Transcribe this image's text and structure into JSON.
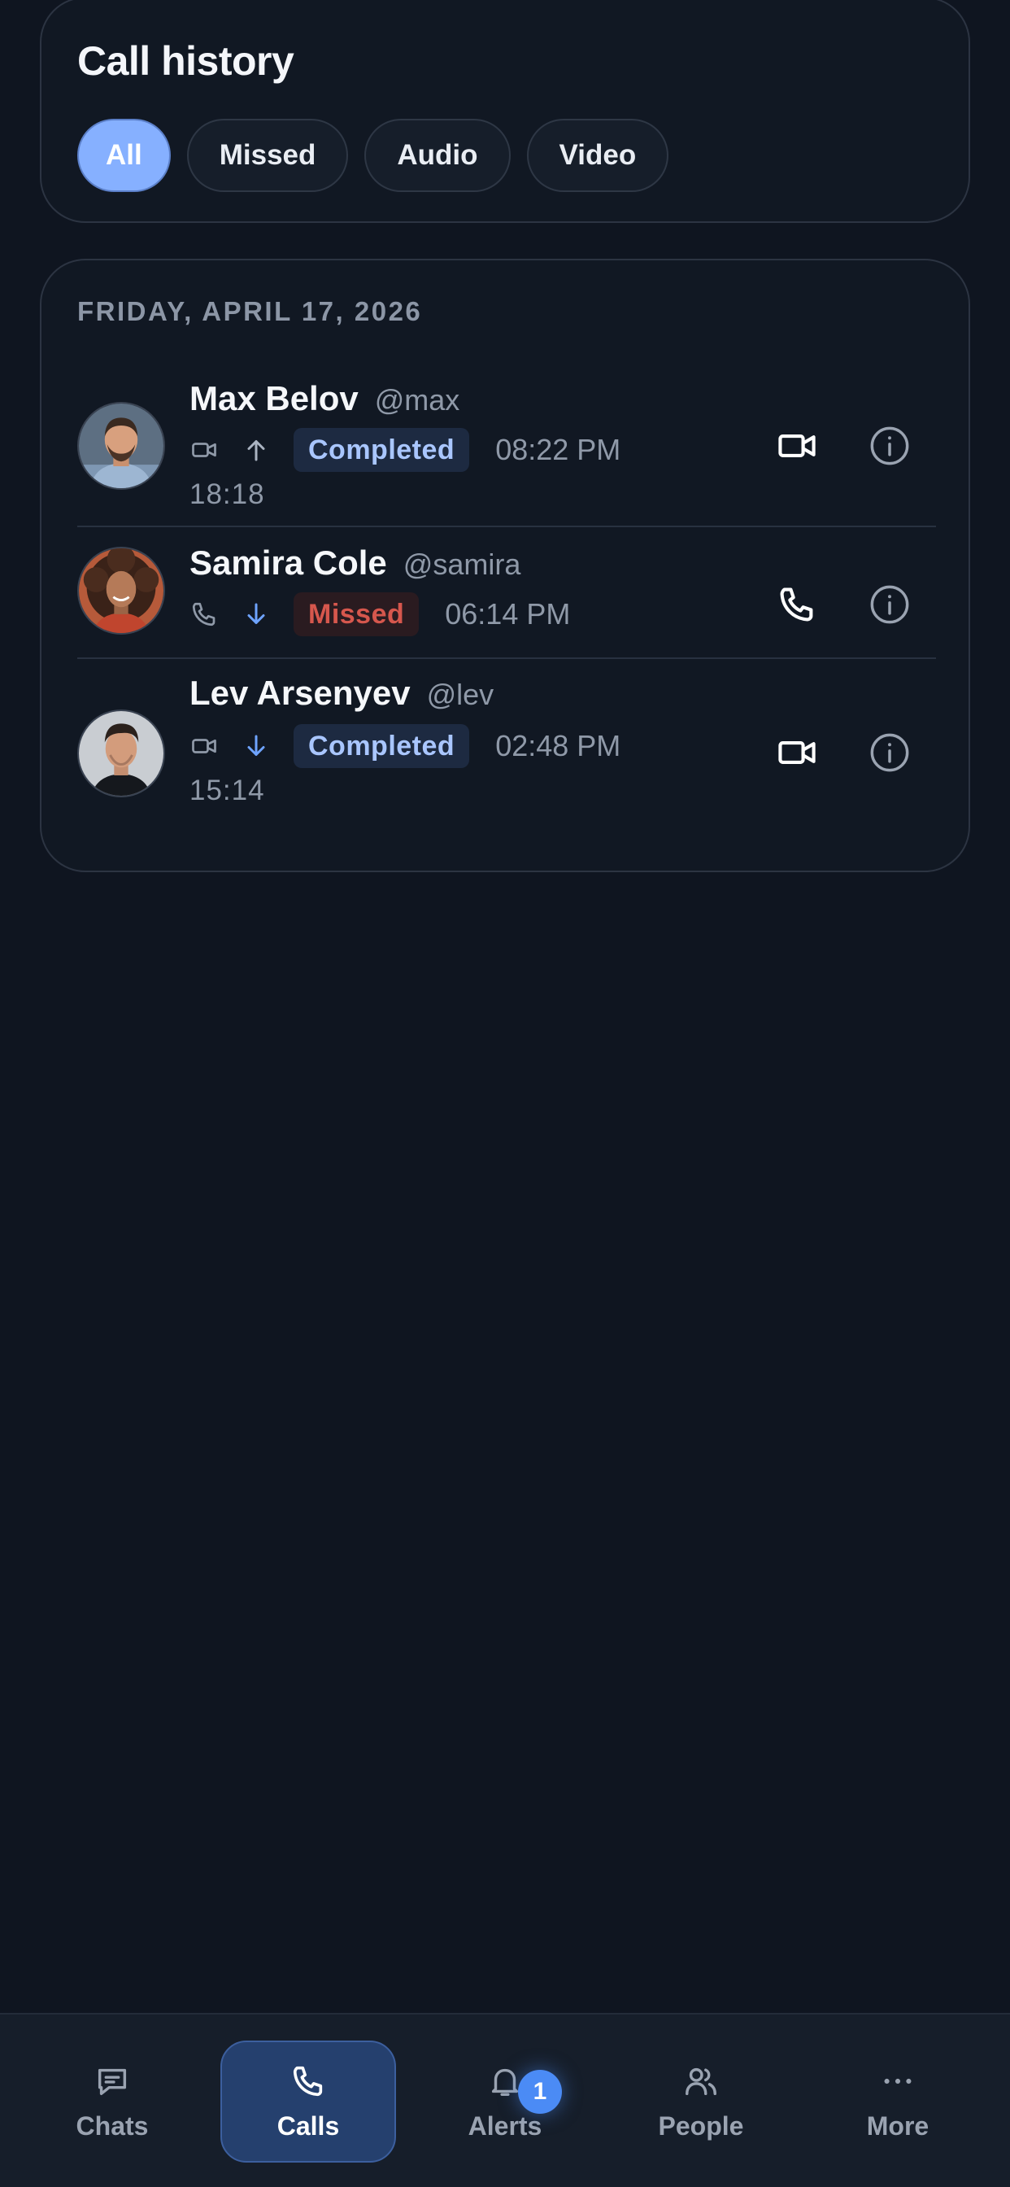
{
  "header": {
    "title": "Call history",
    "filters": [
      {
        "label": "All",
        "active": true
      },
      {
        "label": "Missed",
        "active": false
      },
      {
        "label": "Audio",
        "active": false
      },
      {
        "label": "Video",
        "active": false
      }
    ]
  },
  "calls": {
    "date_label": "FRIDAY, APRIL 17, 2026",
    "items": [
      {
        "name": "Max Belov",
        "handle": "@max",
        "call_type_icon": "video-camera-icon",
        "direction_icon": "arrow-up-icon",
        "status": "Completed",
        "time": "08:22 PM",
        "duration": "18:18",
        "action_icon": "video-camera-icon"
      },
      {
        "name": "Samira Cole",
        "handle": "@samira",
        "call_type_icon": "phone-icon",
        "direction_icon": "arrow-down-icon",
        "status": "Missed",
        "time": "06:14 PM",
        "duration": "",
        "action_icon": "phone-icon"
      },
      {
        "name": "Lev Arsenyev",
        "handle": "@lev",
        "call_type_icon": "video-camera-icon",
        "direction_icon": "arrow-down-icon",
        "status": "Completed",
        "time": "02:48 PM",
        "duration": "15:14",
        "action_icon": "video-camera-icon"
      }
    ]
  },
  "nav": {
    "items": [
      {
        "label": "Chats",
        "icon": "chat-bubble-icon",
        "active": false
      },
      {
        "label": "Calls",
        "icon": "phone-icon",
        "active": true
      },
      {
        "label": "Alerts",
        "icon": "bell-icon",
        "active": false,
        "badge": "1"
      },
      {
        "label": "People",
        "icon": "people-icon",
        "active": false
      },
      {
        "label": "More",
        "icon": "more-dots-icon",
        "active": false
      }
    ]
  },
  "colors": {
    "background": "#0f1520",
    "card": "#111823",
    "accent": "#86b0ff",
    "completed_text": "#a9c6ff",
    "missed_text": "#d6574d",
    "nav_active": "#25406e"
  }
}
